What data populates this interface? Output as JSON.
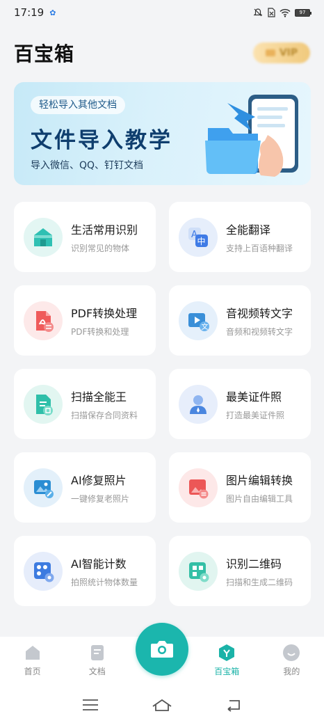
{
  "status_bar": {
    "time": "17:19",
    "battery": "97"
  },
  "header": {
    "title": "百宝箱",
    "vip_label": "VIP"
  },
  "banner": {
    "pill": "轻松导入其他文档",
    "title": "文件导入教学",
    "subtitle": "导入微信、QQ、钉钉文档"
  },
  "features": [
    {
      "title": "生活常用识别",
      "desc": "识别常见的物体",
      "icon": "house-icon",
      "color": "#2fc0b3"
    },
    {
      "title": "全能翻译",
      "desc": "支持上百语种翻译",
      "icon": "translate-icon",
      "color": "#3f7be6"
    },
    {
      "title": "PDF转换处理",
      "desc": "PDF转换和处理",
      "icon": "pdf-icon",
      "color": "#ef5b5b"
    },
    {
      "title": "音视频转文字",
      "desc": "音频和视频转文字",
      "icon": "video-text-icon",
      "color": "#3a8fd8"
    },
    {
      "title": "扫描全能王",
      "desc": "扫描保存合同资料",
      "icon": "scan-document-icon",
      "color": "#2fbfa9"
    },
    {
      "title": "最美证件照",
      "desc": "打造最美证件照",
      "icon": "id-photo-icon",
      "color": "#4a86df"
    },
    {
      "title": "AI修复照片",
      "desc": "一键修复老照片",
      "icon": "photo-repair-icon",
      "color": "#2a8dd3"
    },
    {
      "title": "图片编辑转换",
      "desc": "图片自由编辑工具",
      "icon": "image-edit-icon",
      "color": "#ec5757"
    },
    {
      "title": "AI智能计数",
      "desc": "拍照统计物体数量",
      "icon": "ai-count-icon",
      "color": "#3d7be0"
    },
    {
      "title": "识别二维码",
      "desc": "扫描和生成二维码",
      "icon": "qr-code-icon",
      "color": "#34bfa6"
    }
  ],
  "bottom_nav": {
    "home": "首页",
    "docs": "文档",
    "toolbox": "百宝箱",
    "mine": "我的"
  },
  "colors": {
    "accent": "#1bb6ad",
    "banner_title": "#0f3e6e"
  }
}
